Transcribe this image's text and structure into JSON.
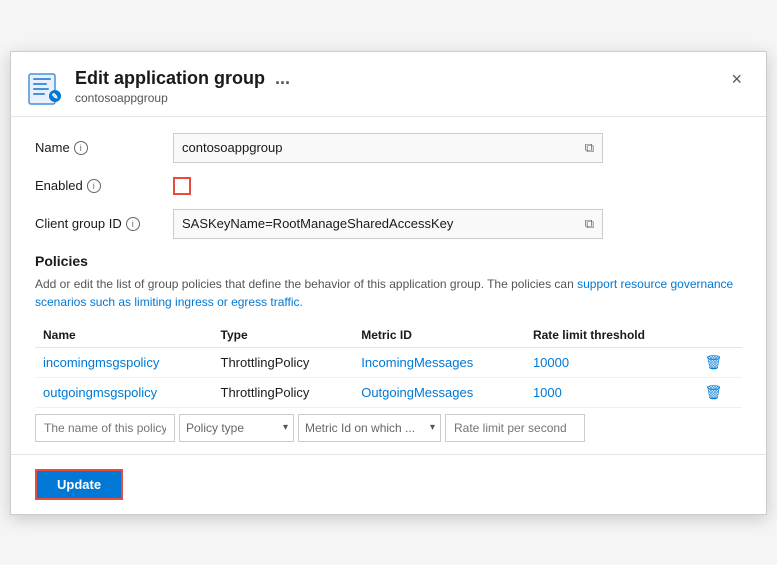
{
  "dialog": {
    "title": "Edit application group",
    "subtitle": "contosoappgroup",
    "dots_label": "...",
    "close_label": "×"
  },
  "form": {
    "name_label": "Name",
    "name_value": "contosoappgroup",
    "enabled_label": "Enabled",
    "client_group_id_label": "Client group ID",
    "client_group_id_value": "SASKeyName=RootManageSharedAccessKey"
  },
  "info_icon": "i",
  "policies": {
    "section_title": "Policies",
    "description_part1": "Add or edit the list of group policies that define the behavior of this application group. The policies can support resource governance scenarios such as limiting ingress or egress traffic.",
    "link_text": "support resource governance scenarios such as limiting ingress or egress traffic.",
    "columns": [
      "Name",
      "Type",
      "Metric ID",
      "Rate limit threshold"
    ],
    "rows": [
      {
        "name": "incomingmsgspolicy",
        "type": "ThrottlingPolicy",
        "metric_id": "IncomingMessages",
        "rate_limit": "10000"
      },
      {
        "name": "outgoingmsgspolicy",
        "type": "ThrottlingPolicy",
        "metric_id": "OutgoingMessages",
        "rate_limit": "1000"
      }
    ],
    "add_row": {
      "name_placeholder": "The name of this policy",
      "type_placeholder": "Policy type",
      "metric_placeholder": "Metric Id on which ...",
      "rate_placeholder": "Rate limit per second"
    }
  },
  "footer": {
    "update_label": "Update"
  }
}
